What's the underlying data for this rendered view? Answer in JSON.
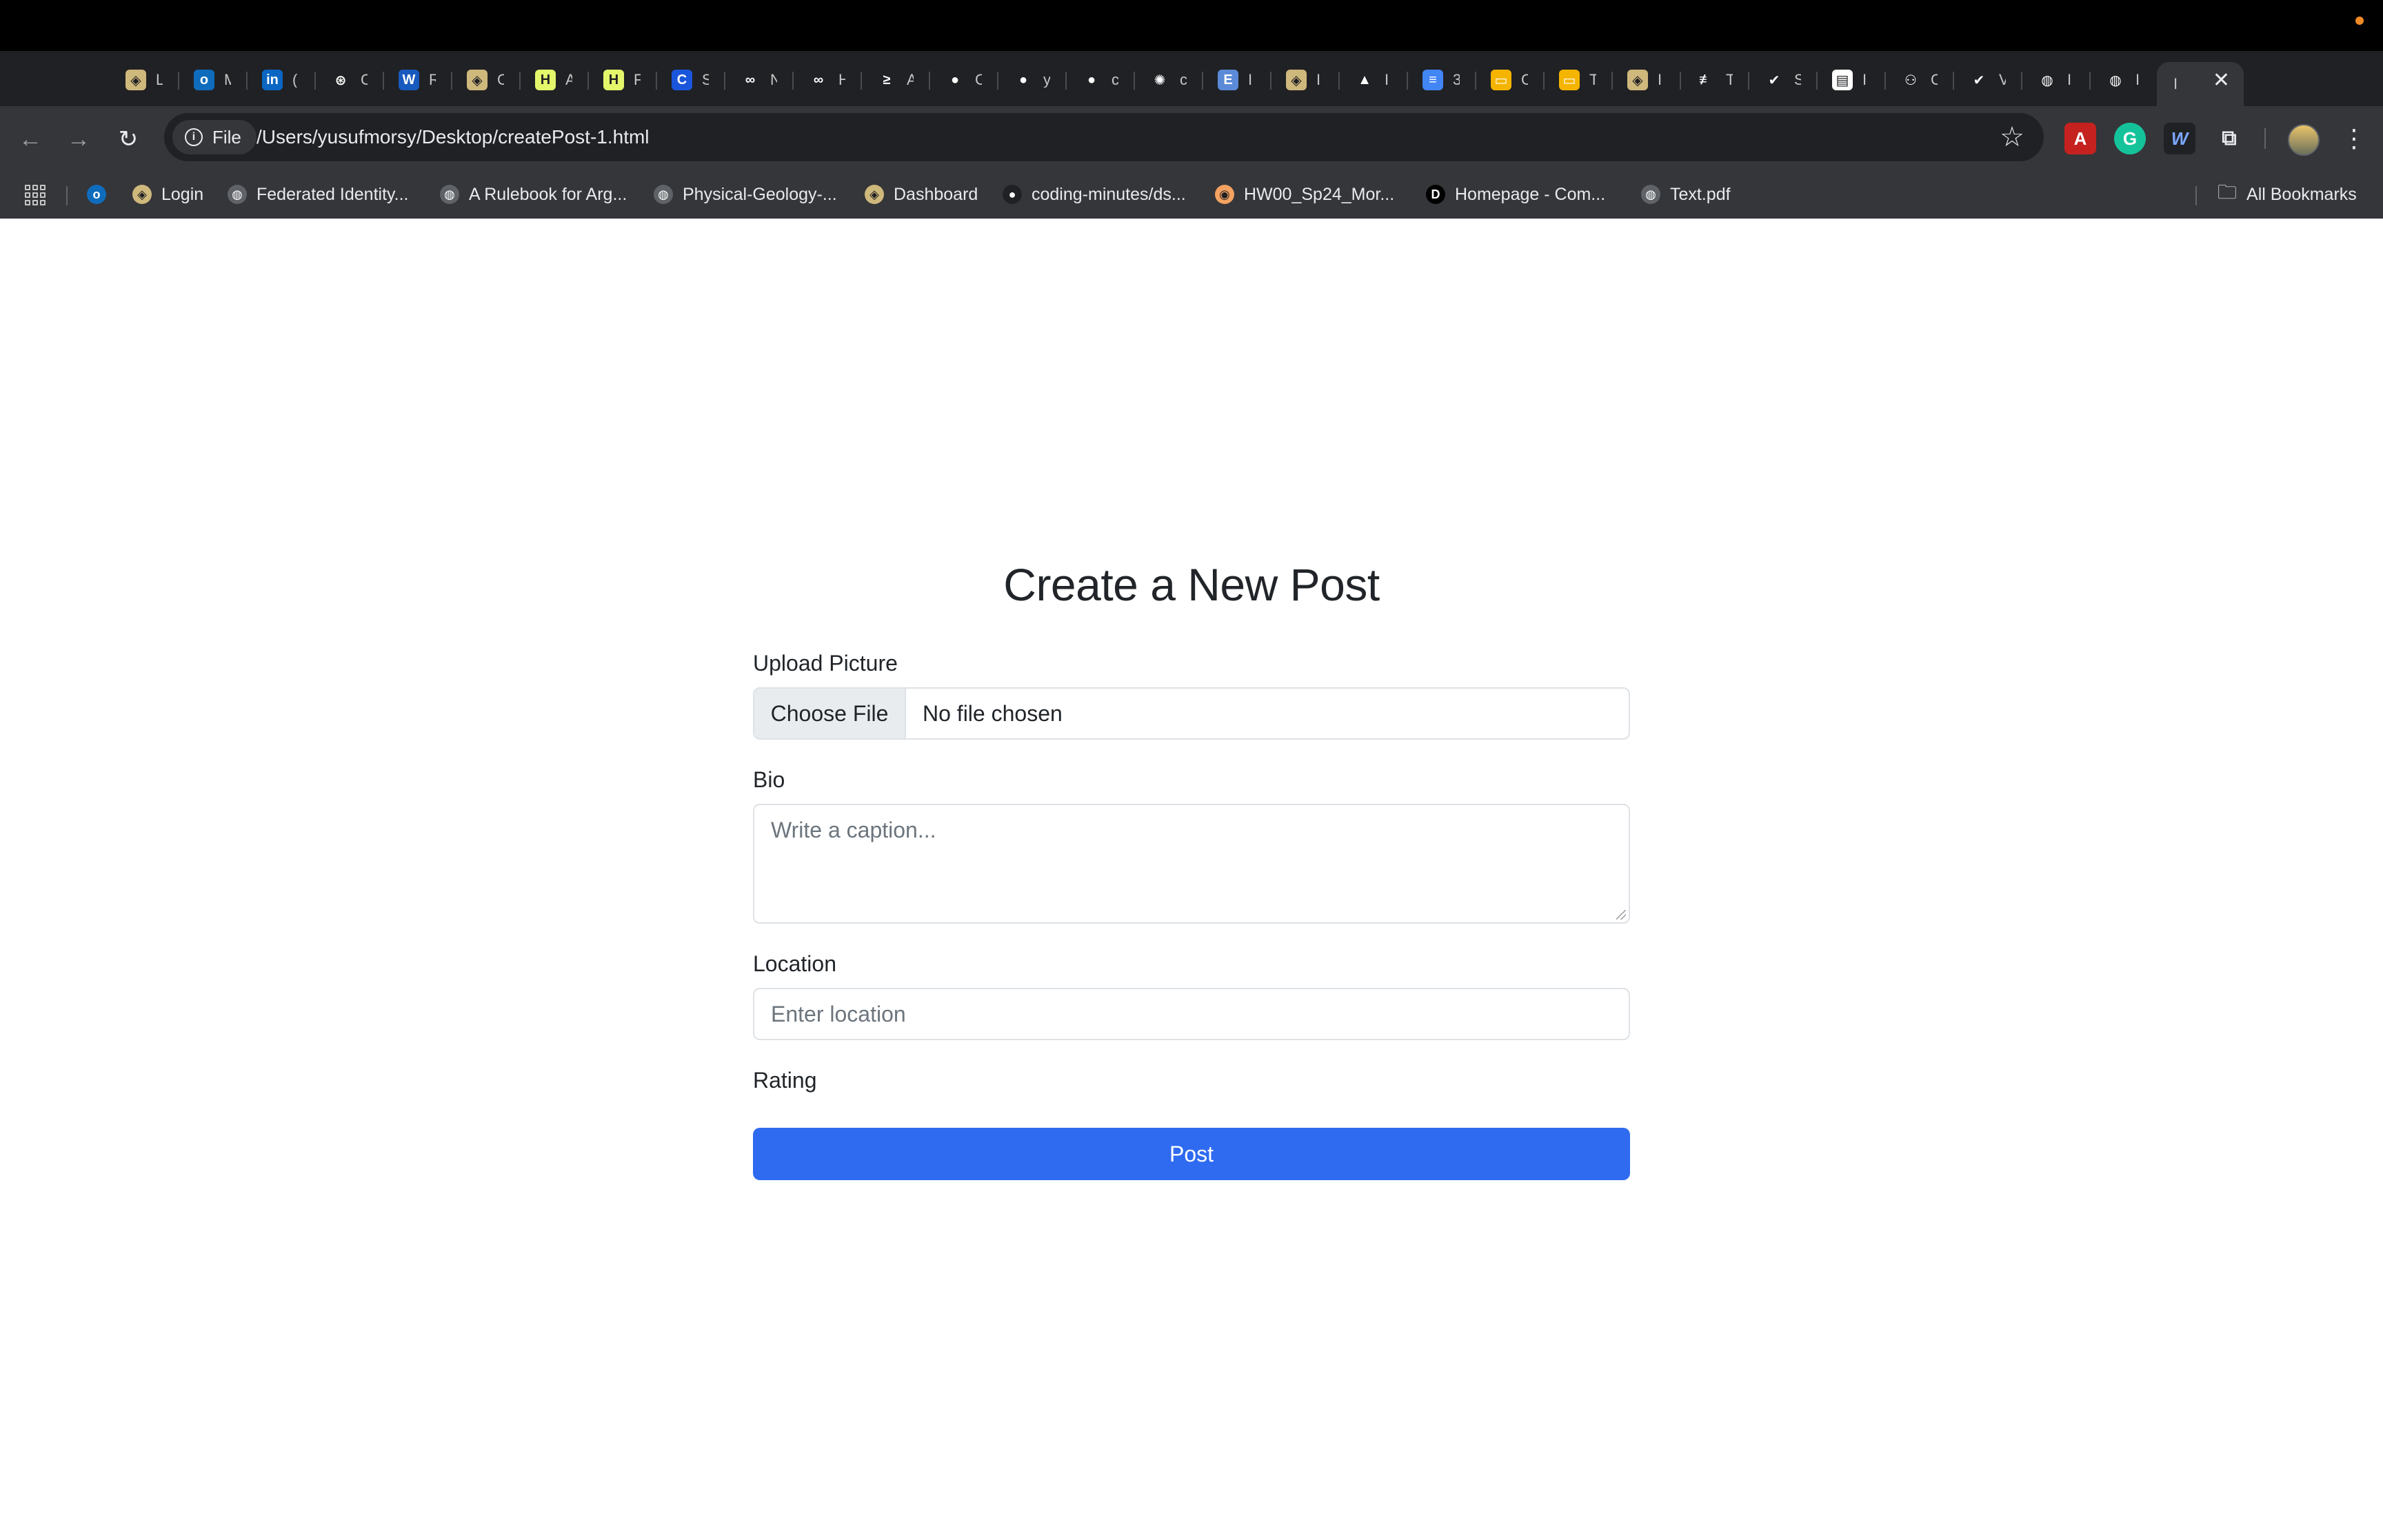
{
  "browser": {
    "tabs": [
      {
        "icon": "cu-icon",
        "letter": "L",
        "color": "#cfb87c",
        "glyph": "◈"
      },
      {
        "icon": "outlook-icon",
        "letter": "M",
        "color": "#0f6cbd",
        "glyph": "o"
      },
      {
        "icon": "linkedin-icon",
        "letter": "(",
        "color": "#0a66c2",
        "glyph": "in"
      },
      {
        "icon": "chatgpt-icon",
        "letter": "C",
        "color": "#202124",
        "glyph": "⊛"
      },
      {
        "icon": "word-icon",
        "letter": "R",
        "color": "#185abd",
        "glyph": "W"
      },
      {
        "icon": "cu-icon",
        "letter": "C",
        "color": "#cfb87c",
        "glyph": "◈"
      },
      {
        "icon": "hint-icon",
        "letter": "A",
        "color": "#e4f76b",
        "glyph": "H"
      },
      {
        "icon": "hint-icon",
        "letter": "F",
        "color": "#e4f76b",
        "glyph": "H"
      },
      {
        "icon": "c-icon",
        "letter": "S",
        "color": "#1a56db",
        "glyph": "C"
      },
      {
        "icon": "meta-icon",
        "letter": "N",
        "color": "#202124",
        "glyph": "∞"
      },
      {
        "icon": "meta-icon",
        "letter": "H",
        "color": "#202124",
        "glyph": "∞"
      },
      {
        "icon": "stack-icon",
        "letter": "A",
        "color": "#202124",
        "glyph": "≥"
      },
      {
        "icon": "github-icon",
        "letter": "C",
        "color": "#202124",
        "glyph": "●"
      },
      {
        "icon": "github-icon",
        "letter": "y",
        "color": "#202124",
        "glyph": "●"
      },
      {
        "icon": "github-icon",
        "letter": "c",
        "color": "#202124",
        "glyph": "●"
      },
      {
        "icon": "openai-icon",
        "letter": "c",
        "color": "#202124",
        "glyph": "✺"
      },
      {
        "icon": "doc-icon",
        "letter": "I",
        "color": "#5b8bd8",
        "glyph": "E"
      },
      {
        "icon": "cu-icon",
        "letter": "I",
        "color": "#cfb87c",
        "glyph": "◈"
      },
      {
        "icon": "drive-icon",
        "letter": "I",
        "color": "#202124",
        "glyph": "▲"
      },
      {
        "icon": "docs-icon",
        "letter": "3",
        "color": "#4285f4",
        "glyph": "≡"
      },
      {
        "icon": "slides-icon",
        "letter": "C",
        "color": "#f4b400",
        "glyph": "▭"
      },
      {
        "icon": "slides-icon",
        "letter": "T",
        "color": "#f4b400",
        "glyph": "▭"
      },
      {
        "icon": "cu-icon",
        "letter": "I",
        "color": "#cfb87c",
        "glyph": "◈"
      },
      {
        "icon": "stripe-icon",
        "letter": "T",
        "color": "#202124",
        "glyph": "≢"
      },
      {
        "icon": "copilot-icon",
        "letter": "S",
        "color": "#202124",
        "glyph": "✔"
      },
      {
        "icon": "notion-icon",
        "letter": "I",
        "color": "#ffffff",
        "glyph": "▤"
      },
      {
        "icon": "discord-icon",
        "letter": "C",
        "color": "#202124",
        "glyph": "⚇"
      },
      {
        "icon": "copilot-icon",
        "letter": "V",
        "color": "#202124",
        "glyph": "✔"
      },
      {
        "icon": "globe-icon",
        "letter": "I",
        "color": "#202124",
        "glyph": "◍"
      },
      {
        "icon": "globe-icon",
        "letter": "I",
        "color": "#202124",
        "glyph": "◍"
      }
    ],
    "active_tab_letter": "I",
    "new_tab": "+",
    "chip_label": "File",
    "url": "/Users/yusufmorsy/Desktop/createPost-1.html",
    "bookmarks": [
      {
        "label": "",
        "icon": "outlook-icon",
        "color": "#0f6cbd",
        "glyph": "o"
      },
      {
        "label": "Login",
        "icon": "cu-icon",
        "color": "#cfb87c",
        "glyph": "◈"
      },
      {
        "label": "Federated Identity...",
        "icon": "globe-icon",
        "color": "#5f6368",
        "glyph": "◍"
      },
      {
        "label": "A Rulebook for Arg...",
        "icon": "globe-icon",
        "color": "#5f6368",
        "glyph": "◍"
      },
      {
        "label": "Physical-Geology-...",
        "icon": "globe-icon",
        "color": "#5f6368",
        "glyph": "◍"
      },
      {
        "label": "Dashboard",
        "icon": "cu-icon",
        "color": "#cfb87c",
        "glyph": "◈"
      },
      {
        "label": "coding-minutes/ds...",
        "icon": "github-icon",
        "color": "#202124",
        "glyph": "●"
      },
      {
        "label": "HW00_Sp24_Mor...",
        "icon": "gradescope-icon",
        "color": "#f4a261",
        "glyph": "◉"
      },
      {
        "label": "Homepage - Com...",
        "icon": "d2l-icon",
        "color": "#000000",
        "glyph": "D"
      },
      {
        "label": "Text.pdf",
        "icon": "globe-icon",
        "color": "#5f6368",
        "glyph": "◍"
      }
    ],
    "all_bookmarks": "All Bookmarks"
  },
  "form": {
    "title": "Create a New Post",
    "upload_label": "Upload Picture",
    "choose_file": "Choose File",
    "file_status": "No file chosen",
    "bio_label": "Bio",
    "bio_placeholder": "Write a caption...",
    "location_label": "Location",
    "location_placeholder": "Enter location",
    "rating_label": "Rating",
    "post_button": "Post"
  },
  "colors": {
    "accent": "#2f6bf0",
    "chrome_dark": "#202124",
    "chrome_mid": "#35363a"
  }
}
